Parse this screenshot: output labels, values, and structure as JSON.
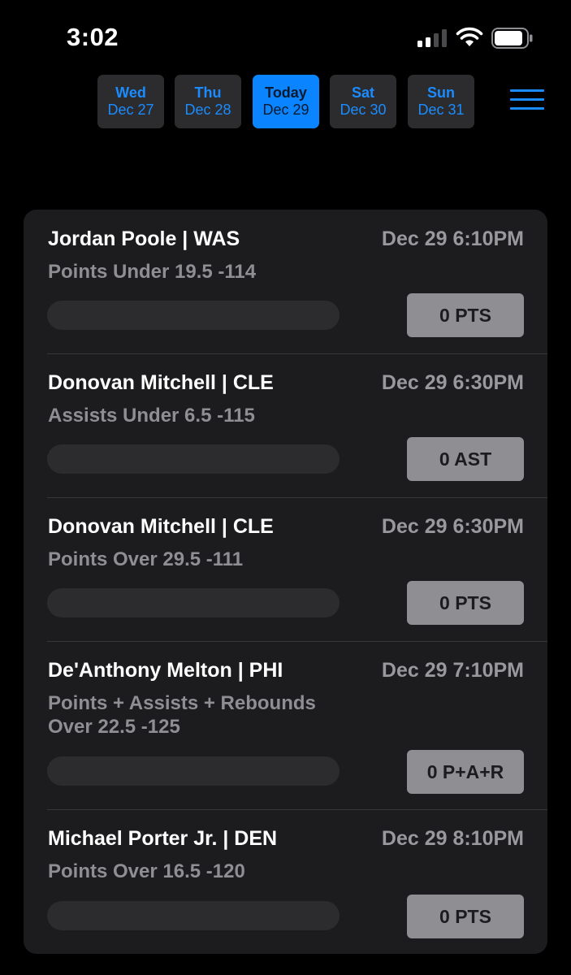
{
  "status_bar": {
    "time": "3:02",
    "signal_icon": "cellular-signal-icon",
    "wifi_icon": "wifi-icon",
    "battery_icon": "battery-icon"
  },
  "date_tabs": [
    {
      "day": "Wed",
      "date": "Dec 27",
      "active": false
    },
    {
      "day": "Thu",
      "date": "Dec 28",
      "active": false
    },
    {
      "day": "Today",
      "date": "Dec 29",
      "active": true
    },
    {
      "day": "Sat",
      "date": "Dec 30",
      "active": false
    },
    {
      "day": "Sun",
      "date": "Dec 31",
      "active": false
    }
  ],
  "menu_icon": "hamburger-menu-icon",
  "picks": [
    {
      "player": "Jordan Poole | WAS",
      "time": "Dec 29 6:10PM",
      "market": "Points Under 19.5 -114",
      "progress": 0,
      "stat": "0 PTS"
    },
    {
      "player": "Donovan Mitchell | CLE",
      "time": "Dec 29 6:30PM",
      "market": "Assists Under 6.5 -115",
      "progress": 0,
      "stat": "0 AST"
    },
    {
      "player": "Donovan Mitchell | CLE",
      "time": "Dec 29 6:30PM",
      "market": "Points Over 29.5 -111",
      "progress": 0,
      "stat": "0 PTS"
    },
    {
      "player": "De'Anthony Melton | PHI",
      "time": "Dec 29 7:10PM",
      "market": "Points + Assists + Rebounds Over 22.5 -125",
      "progress": 0,
      "stat": "0 P+A+R"
    },
    {
      "player": "Michael Porter Jr. | DEN",
      "time": "Dec 29 8:10PM",
      "market": "Points Over 16.5 -120",
      "progress": 0,
      "stat": "0 PTS"
    }
  ],
  "colors": {
    "accent": "#0a84ff",
    "card_background": "#1c1c1e",
    "secondary_text": "#8e8e93",
    "badge_background": "#8e8e93"
  }
}
